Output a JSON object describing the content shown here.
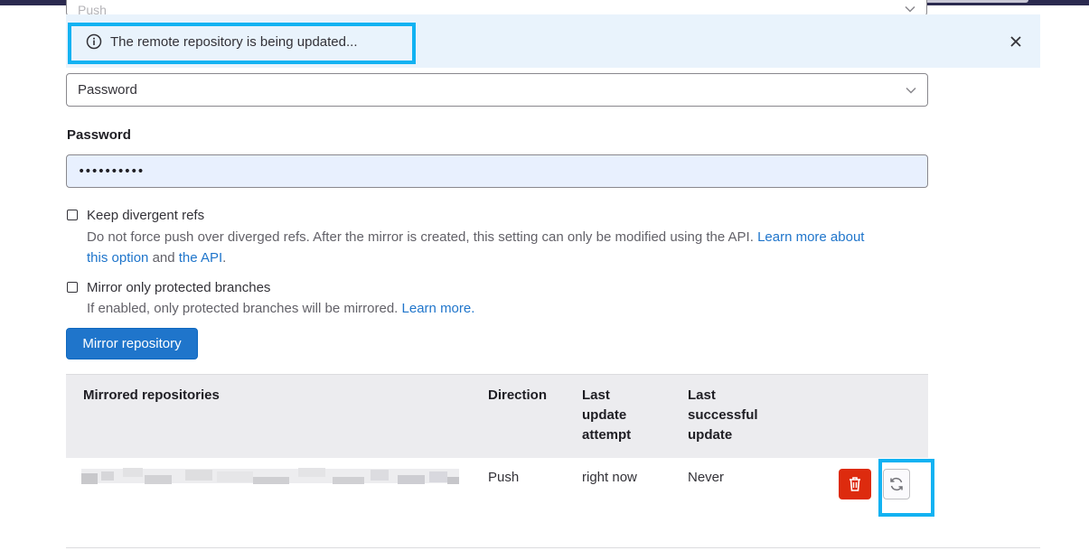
{
  "topbar": {
    "bg": "#2b2a4f"
  },
  "direction_select": {
    "value": "Push"
  },
  "alert": {
    "message": "The remote repository is being updated...",
    "icon": "info-circle-icon",
    "close_icon": "close-icon",
    "bg": "#e9f3fc"
  },
  "auth_method_select": {
    "value": "Password"
  },
  "password": {
    "label": "Password",
    "value": "••••••••••"
  },
  "keep_divergent": {
    "label": "Keep divergent refs",
    "help_prefix": "Do not force push over diverged refs. After the mirror is created, this setting can only be modified using the API.",
    "link1_part1": "Learn more about",
    "link1_part2": "this option",
    "help_middle": "and",
    "link2": "the API",
    "help_suffix": "."
  },
  "protected_only": {
    "label": "Mirror only protected branches",
    "help": "If enabled, only protected branches will be mirrored.",
    "link": "Learn more."
  },
  "mirror_button": {
    "label": "Mirror repository",
    "color": "#1f75cb"
  },
  "table": {
    "headers": {
      "repos": "Mirrored repositories",
      "direction": "Direction",
      "last_attempt_1": "Last",
      "last_attempt_2": "update",
      "last_attempt_3": "attempt",
      "last_success_1": "Last",
      "last_success_2": "successful",
      "last_success_3": "update"
    },
    "rows": [
      {
        "direction": "Push",
        "last_attempt": "right now",
        "last_success": "Never",
        "delete_icon": "trash-icon",
        "update_icon": "refresh-icon"
      }
    ]
  },
  "highlight_color": "#12b2f2"
}
